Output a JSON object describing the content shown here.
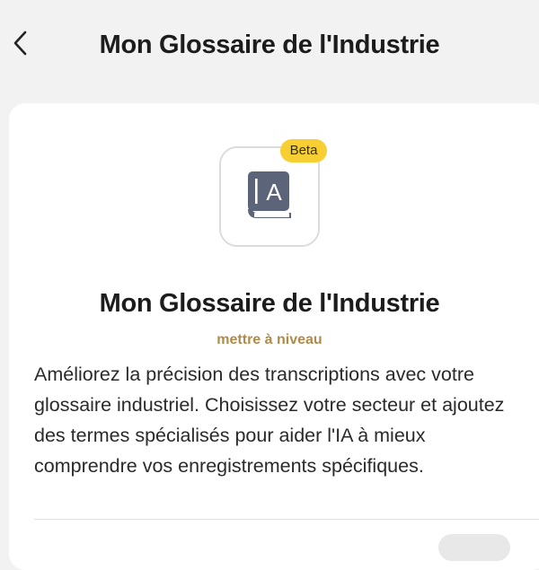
{
  "header": {
    "back_icon": "chevron-left-icon",
    "title": "Mon Glossaire de l'Industrie"
  },
  "feature": {
    "icon": "glossary-book-icon",
    "icon_letter": "A",
    "badge": "Beta",
    "title": "Mon Glossaire de l'Industrie",
    "upgrade_label": "mettre à niveau",
    "description": "Améliorez la précision des transcriptions avec votre glossaire industriel. Choisissez votre secteur et ajoutez des termes spécialisés pour aider l'IA à mieux comprendre vos enregistrements spécifiques."
  },
  "colors": {
    "background": "#f2f2f3",
    "card": "#ffffff",
    "badge": "#f7cf33",
    "upgrade_link": "#b08a4b",
    "book_icon": "#5b6479"
  }
}
